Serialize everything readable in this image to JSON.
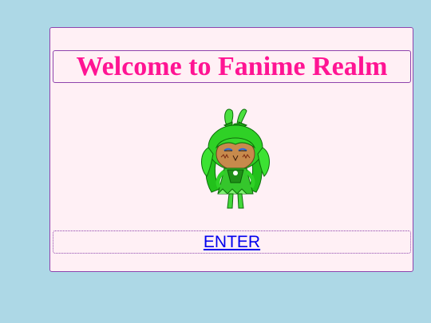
{
  "header": {
    "title": "Welcome to Fanime Realm"
  },
  "mascot": {
    "icon": "chibi-green-character-illustration"
  },
  "enter": {
    "label": "ENTER"
  },
  "colors": {
    "page_background": "#add8e6",
    "card_background": "#fff0f5",
    "border": "#8e44ad",
    "title": "#ff1493",
    "link": "#0000ee"
  }
}
